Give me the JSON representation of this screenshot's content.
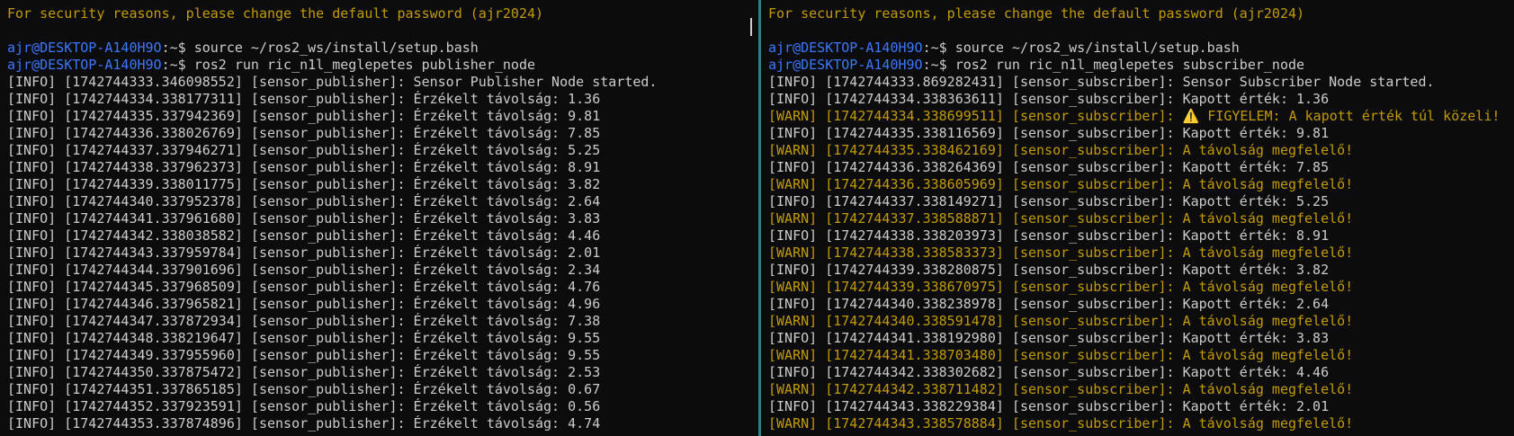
{
  "left": {
    "banner": "For security reasons, please change the default password (ajr2024)",
    "prompt1_user": "ajr@DESKTOP-A140H9O",
    "prompt1_rest": ":~$ source ~/ros2_ws/install/setup.bash",
    "prompt2_user": "ajr@DESKTOP-A140H9O",
    "prompt2_rest": ":~$ ros2 run ric_n1l_meglepetes publisher_node",
    "logs": [
      {
        "level": "info",
        "text": "[INFO] [1742744333.346098552] [sensor_publisher]: Sensor Publisher Node started."
      },
      {
        "level": "info",
        "text": "[INFO] [1742744334.338177311] [sensor_publisher]: Érzékelt távolság: 1.36"
      },
      {
        "level": "info",
        "text": "[INFO] [1742744335.337942369] [sensor_publisher]: Érzékelt távolság: 9.81"
      },
      {
        "level": "info",
        "text": "[INFO] [1742744336.338026769] [sensor_publisher]: Érzékelt távolság: 7.85"
      },
      {
        "level": "info",
        "text": "[INFO] [1742744337.337946271] [sensor_publisher]: Érzékelt távolság: 5.25"
      },
      {
        "level": "info",
        "text": "[INFO] [1742744338.337962373] [sensor_publisher]: Érzékelt távolság: 8.91"
      },
      {
        "level": "info",
        "text": "[INFO] [1742744339.338011775] [sensor_publisher]: Érzékelt távolság: 3.82"
      },
      {
        "level": "info",
        "text": "[INFO] [1742744340.337952378] [sensor_publisher]: Érzékelt távolság: 2.64"
      },
      {
        "level": "info",
        "text": "[INFO] [1742744341.337961680] [sensor_publisher]: Érzékelt távolság: 3.83"
      },
      {
        "level": "info",
        "text": "[INFO] [1742744342.338038582] [sensor_publisher]: Érzékelt távolság: 4.46"
      },
      {
        "level": "info",
        "text": "[INFO] [1742744343.337959784] [sensor_publisher]: Érzékelt távolság: 2.01"
      },
      {
        "level": "info",
        "text": "[INFO] [1742744344.337901696] [sensor_publisher]: Érzékelt távolság: 2.34"
      },
      {
        "level": "info",
        "text": "[INFO] [1742744345.337968509] [sensor_publisher]: Érzékelt távolság: 4.76"
      },
      {
        "level": "info",
        "text": "[INFO] [1742744346.337965821] [sensor_publisher]: Érzékelt távolság: 4.96"
      },
      {
        "level": "info",
        "text": "[INFO] [1742744347.337872934] [sensor_publisher]: Érzékelt távolság: 7.38"
      },
      {
        "level": "info",
        "text": "[INFO] [1742744348.338219647] [sensor_publisher]: Érzékelt távolság: 9.55"
      },
      {
        "level": "info",
        "text": "[INFO] [1742744349.337955960] [sensor_publisher]: Érzékelt távolság: 9.55"
      },
      {
        "level": "info",
        "text": "[INFO] [1742744350.337875472] [sensor_publisher]: Érzékelt távolság: 2.53"
      },
      {
        "level": "info",
        "text": "[INFO] [1742744351.337865185] [sensor_publisher]: Érzékelt távolság: 0.67"
      },
      {
        "level": "info",
        "text": "[INFO] [1742744352.337923591] [sensor_publisher]: Érzékelt távolság: 0.56"
      },
      {
        "level": "info",
        "text": "[INFO] [1742744353.337874896] [sensor_publisher]: Érzékelt távolság: 4.74"
      }
    ]
  },
  "right": {
    "banner": "For security reasons, please change the default password (ajr2024)",
    "prompt1_user": "ajr@DESKTOP-A140H9O",
    "prompt1_rest": ":~$ source ~/ros2_ws/install/setup.bash",
    "prompt2_user": "ajr@DESKTOP-A140H9O",
    "prompt2_rest": ":~$ ros2 run ric_n1l_meglepetes subscriber_node",
    "logs": [
      {
        "level": "info",
        "text": "[INFO] [1742744333.869282431] [sensor_subscriber]: Sensor Subscriber Node started."
      },
      {
        "level": "info",
        "text": "[INFO] [1742744334.338363611] [sensor_subscriber]: Kapott érték: 1.36"
      },
      {
        "level": "warn",
        "text": "[WARN] [1742744334.338699511] [sensor_subscriber]: ⚠️ FIGYELEM: A kapott érték túl közeli!"
      },
      {
        "level": "info",
        "text": "[INFO] [1742744335.338116569] [sensor_subscriber]: Kapott érték: 9.81"
      },
      {
        "level": "warn",
        "text": "[WARN] [1742744335.338462169] [sensor_subscriber]: A távolság megfelelő!"
      },
      {
        "level": "info",
        "text": "[INFO] [1742744336.338264369] [sensor_subscriber]: Kapott érték: 7.85"
      },
      {
        "level": "warn",
        "text": "[WARN] [1742744336.338605969] [sensor_subscriber]: A távolság megfelelő!"
      },
      {
        "level": "info",
        "text": "[INFO] [1742744337.338149271] [sensor_subscriber]: Kapott érték: 5.25"
      },
      {
        "level": "warn",
        "text": "[WARN] [1742744337.338588871] [sensor_subscriber]: A távolság megfelelő!"
      },
      {
        "level": "info",
        "text": "[INFO] [1742744338.338203973] [sensor_subscriber]: Kapott érték: 8.91"
      },
      {
        "level": "warn",
        "text": "[WARN] [1742744338.338583373] [sensor_subscriber]: A távolság megfelelő!"
      },
      {
        "level": "info",
        "text": "[INFO] [1742744339.338280875] [sensor_subscriber]: Kapott érték: 3.82"
      },
      {
        "level": "warn",
        "text": "[WARN] [1742744339.338670975] [sensor_subscriber]: A távolság megfelelő!"
      },
      {
        "level": "info",
        "text": "[INFO] [1742744340.338238978] [sensor_subscriber]: Kapott érték: 2.64"
      },
      {
        "level": "warn",
        "text": "[WARN] [1742744340.338591478] [sensor_subscriber]: A távolság megfelelő!"
      },
      {
        "level": "info",
        "text": "[INFO] [1742744341.338192980] [sensor_subscriber]: Kapott érték: 3.83"
      },
      {
        "level": "warn",
        "text": "[WARN] [1742744341.338703480] [sensor_subscriber]: A távolság megfelelő!"
      },
      {
        "level": "info",
        "text": "[INFO] [1742744342.338302682] [sensor_subscriber]: Kapott érték: 4.46"
      },
      {
        "level": "warn",
        "text": "[WARN] [1742744342.338711482] [sensor_subscriber]: A távolság megfelelő!"
      },
      {
        "level": "info",
        "text": "[INFO] [1742744343.338229384] [sensor_subscriber]: Kapott érték: 2.01"
      },
      {
        "level": "warn",
        "text": "[WARN] [1742744343.338578884] [sensor_subscriber]: A távolság megfelelő!"
      }
    ]
  },
  "colors": {
    "background": "#0c0c0c",
    "text": "#cccccc",
    "warn": "#c19c00",
    "user": "#3b78ff",
    "divider": "#2d7d8a"
  }
}
